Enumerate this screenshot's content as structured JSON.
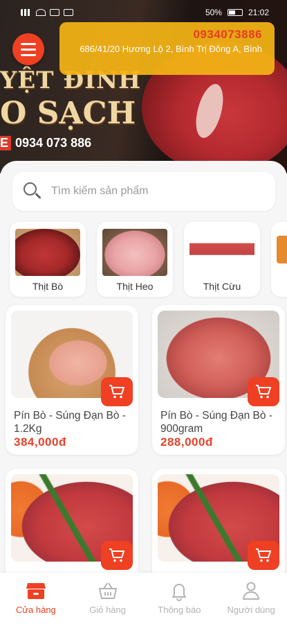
{
  "status_bar": {
    "battery": "50%",
    "time": "21:02",
    "battery_level": 0.5
  },
  "hero": {
    "brand_line1": "YỆT ĐINH",
    "brand_line2": "O SẠCH",
    "brand_phone": "0934 073 886"
  },
  "contact": {
    "phone": "0934073886",
    "address": "686/41/20 Hương Lộ 2, Bình Trị Đông A, Bình"
  },
  "search": {
    "placeholder": "Tìm kiếm sản phẩm"
  },
  "categories": [
    {
      "label": "Thịt Bò"
    },
    {
      "label": "Thịt Heo"
    },
    {
      "label": "Thịt Cừu"
    }
  ],
  "products": [
    {
      "name": "Pín Bò - Súng Đạn Bò - 1.2Kg",
      "price": "384,000đ"
    },
    {
      "name": "Pín Bò - Súng Đạn Bò - 900gram",
      "price": "288,000đ"
    },
    {
      "name": "",
      "price": ""
    },
    {
      "name": "",
      "price": ""
    }
  ],
  "bottom_nav": [
    {
      "label": "Cửa hàng",
      "icon": "store-icon",
      "active": true
    },
    {
      "label": "Giỏ hàng",
      "icon": "basket-icon",
      "active": false
    },
    {
      "label": "Thông báo",
      "icon": "bell-icon",
      "active": false
    },
    {
      "label": "Người dùng",
      "icon": "user-icon",
      "active": false
    }
  ],
  "colors": {
    "accent": "#ef4023",
    "contact_bg": "#f4b416",
    "price": "#e8412a"
  }
}
